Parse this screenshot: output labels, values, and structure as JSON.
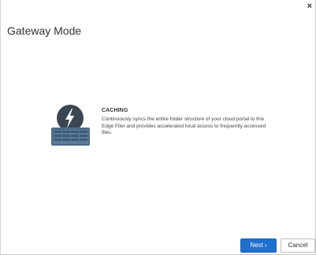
{
  "dialog": {
    "title": "Gateway Mode",
    "close_label": "×"
  },
  "option": {
    "heading": "CACHING",
    "description": "Continuously syncs the entire folder structure of your cloud portal to this Edge Filer and provides accelerated local access to frequently accessed files.",
    "icon": "lightning-bolt-server-icon"
  },
  "buttons": {
    "next_label": "Next ›",
    "cancel_label": "Cancel"
  },
  "colors": {
    "accent": "#1f6fcf",
    "icon_dark": "#3a4651",
    "icon_server": "#4a6b8a"
  }
}
